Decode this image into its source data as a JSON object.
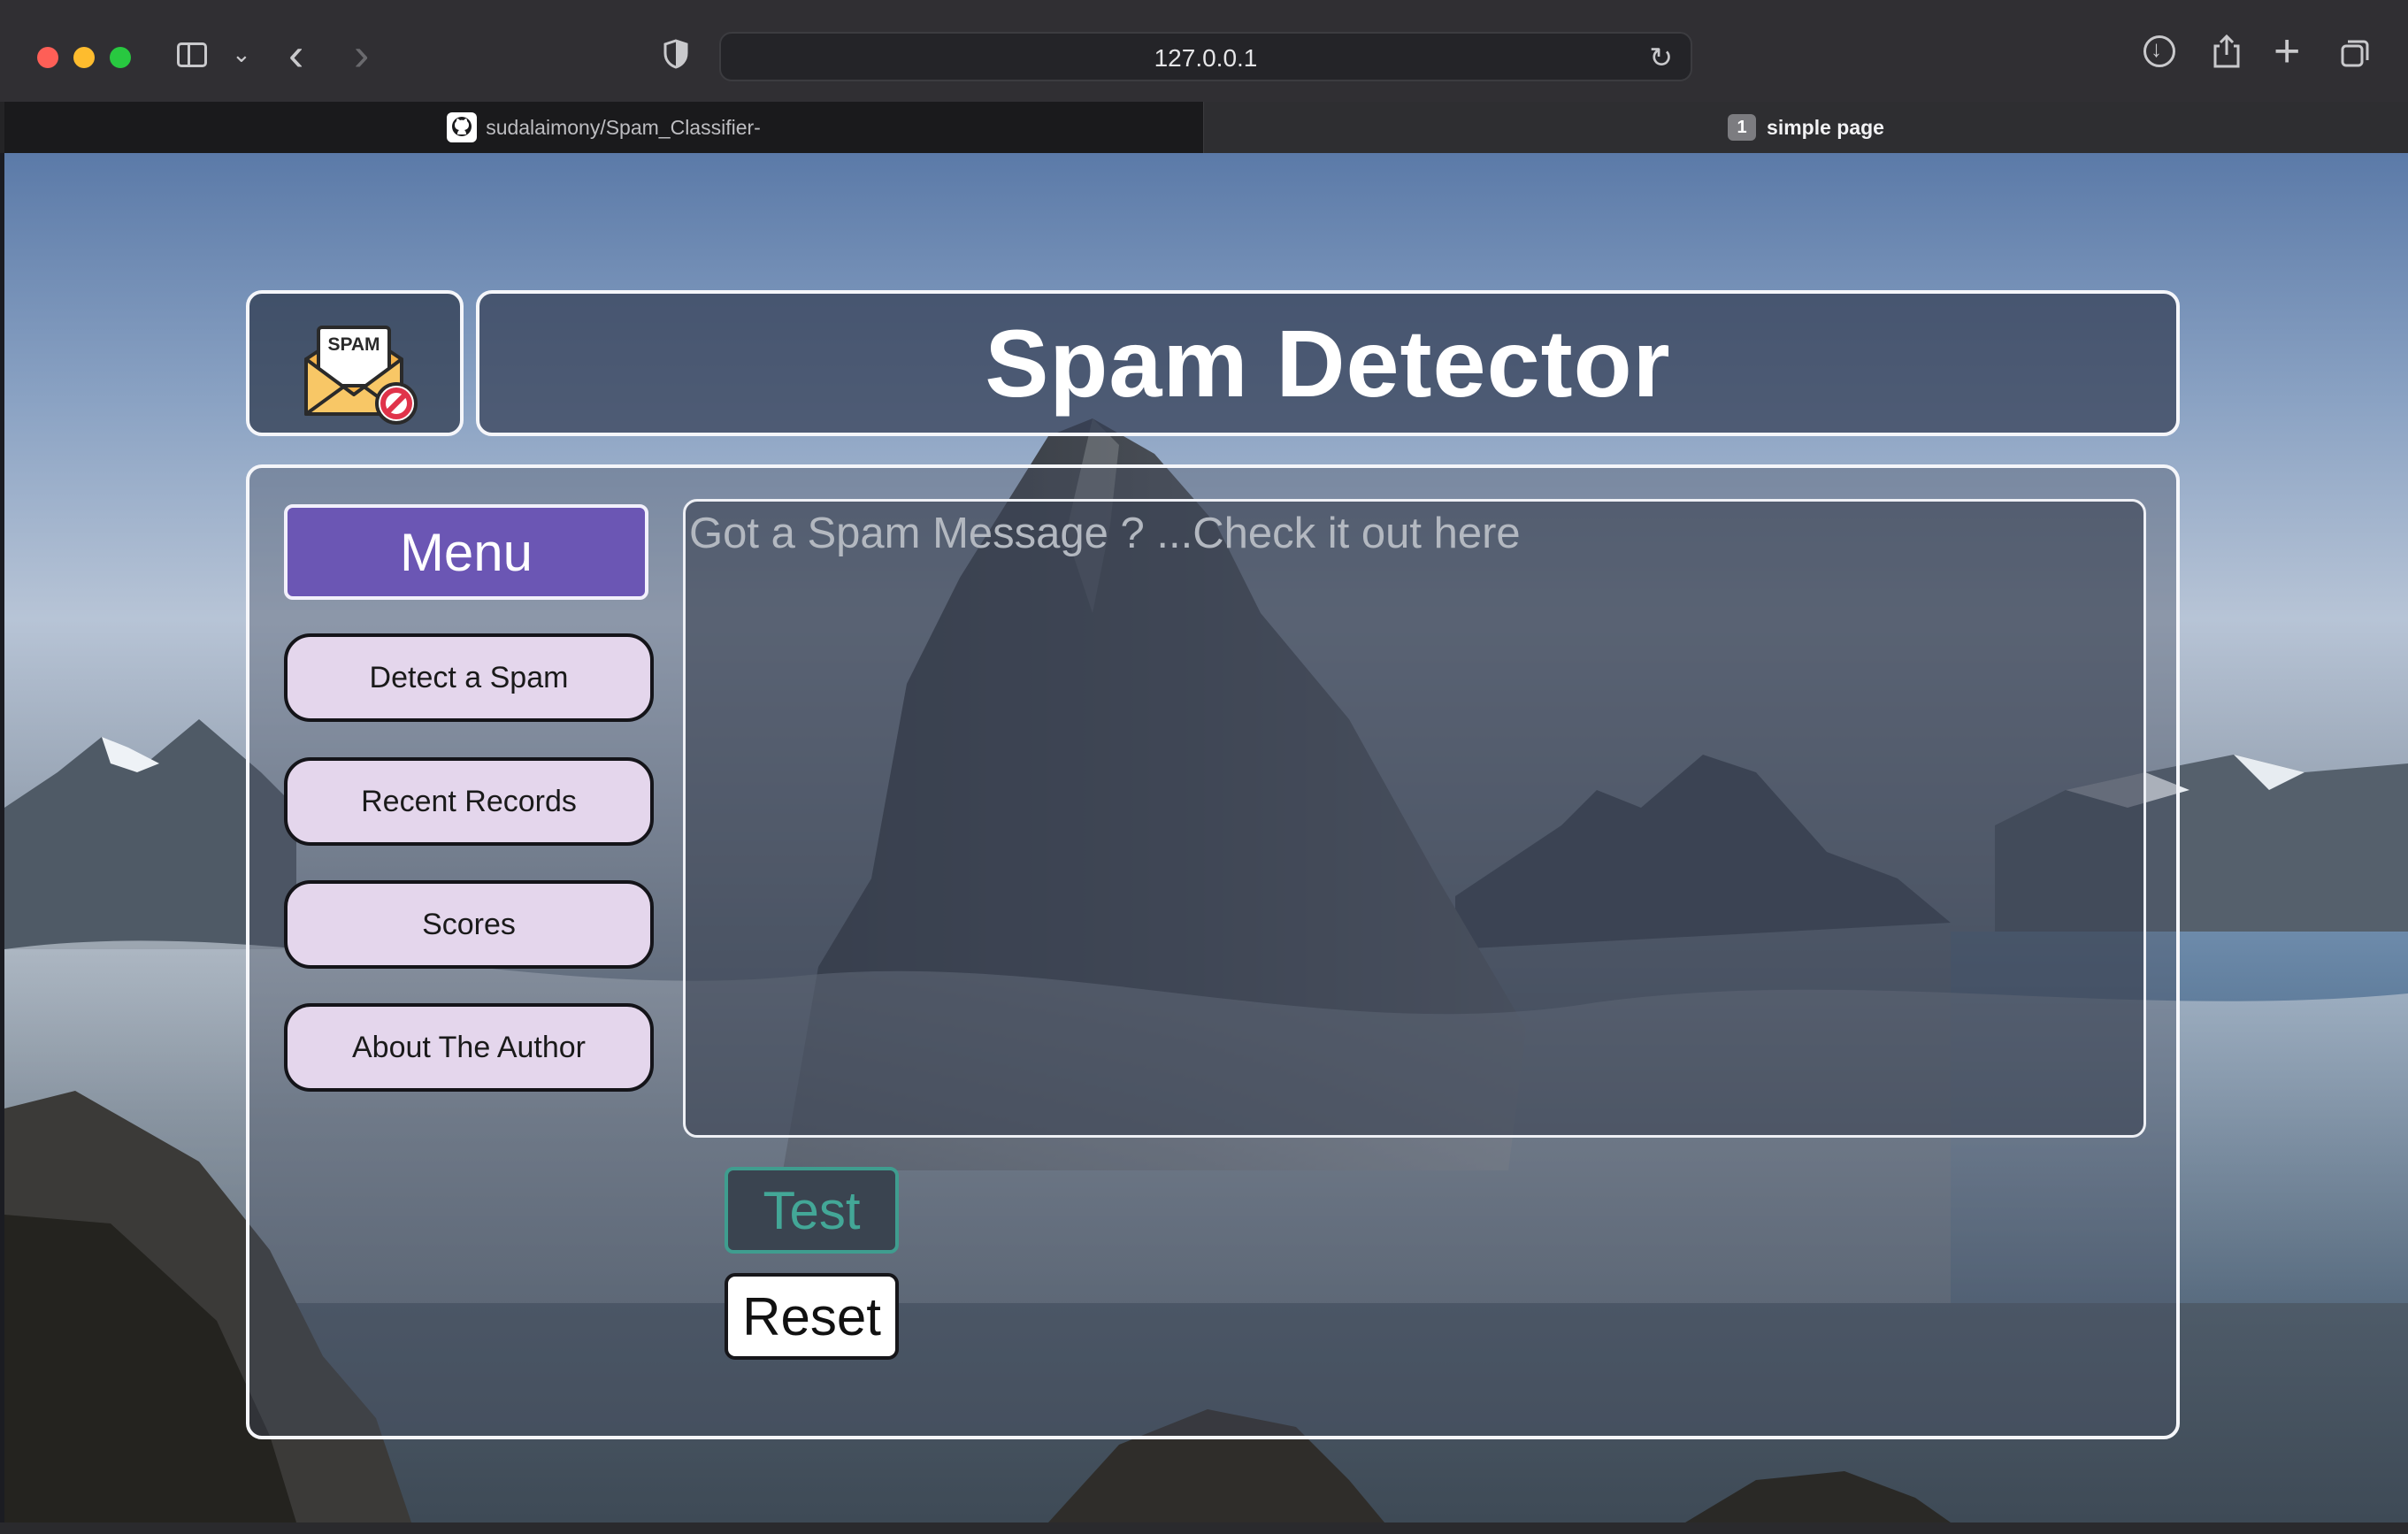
{
  "browser": {
    "url": "127.0.0.1",
    "tabs": [
      {
        "label": "sudalaimony/Spam_Classifier-",
        "icon": "github-icon"
      },
      {
        "label": "simple page",
        "badge": "1"
      }
    ]
  },
  "page": {
    "title": "Spam Detector",
    "logo_text": "SPAM",
    "menu_label": "Menu",
    "nav": [
      {
        "label": "Detect a Spam"
      },
      {
        "label": "Recent Records"
      },
      {
        "label": "Scores"
      },
      {
        "label": "About The Author"
      }
    ],
    "message_placeholder": "Got a Spam Message ? ...Check it out here",
    "message_value": "",
    "test_label": "Test",
    "reset_label": "Reset"
  },
  "colors": {
    "menu_accent": "#6b56b4",
    "nav_button_bg": "#e4d6ec",
    "test_accent": "#43a797"
  }
}
